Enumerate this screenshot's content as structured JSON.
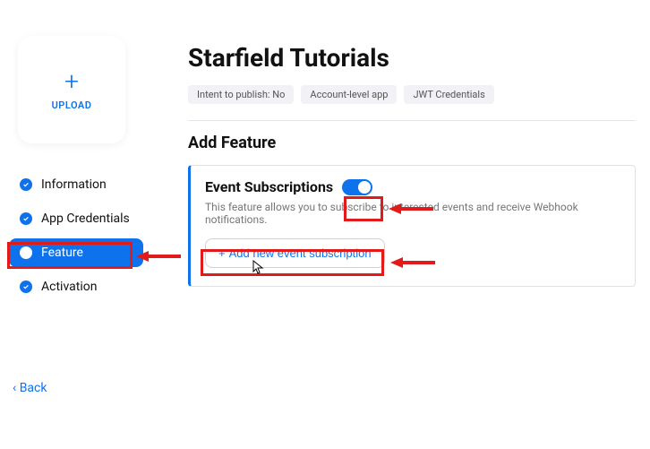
{
  "sidebar": {
    "upload_label": "UPLOAD",
    "items": [
      {
        "label": "Information",
        "active": false,
        "checked": true
      },
      {
        "label": "App Credentials",
        "active": false,
        "checked": true
      },
      {
        "label": "Feature",
        "active": true,
        "checked": false
      },
      {
        "label": "Activation",
        "active": false,
        "checked": true
      }
    ]
  },
  "back_label": "Back",
  "main": {
    "title": "Starfield Tutorials",
    "badges": [
      "Intent to publish: No",
      "Account-level app",
      "JWT Credentials"
    ],
    "section_title": "Add Feature"
  },
  "feature": {
    "title": "Event Subscriptions",
    "toggle_on": true,
    "description": "This feature allows you to subscribe to interested events and receive Webhook notifications.",
    "add_button": "Add new event subscription"
  },
  "annotations": {
    "color": "#e21a1a"
  }
}
